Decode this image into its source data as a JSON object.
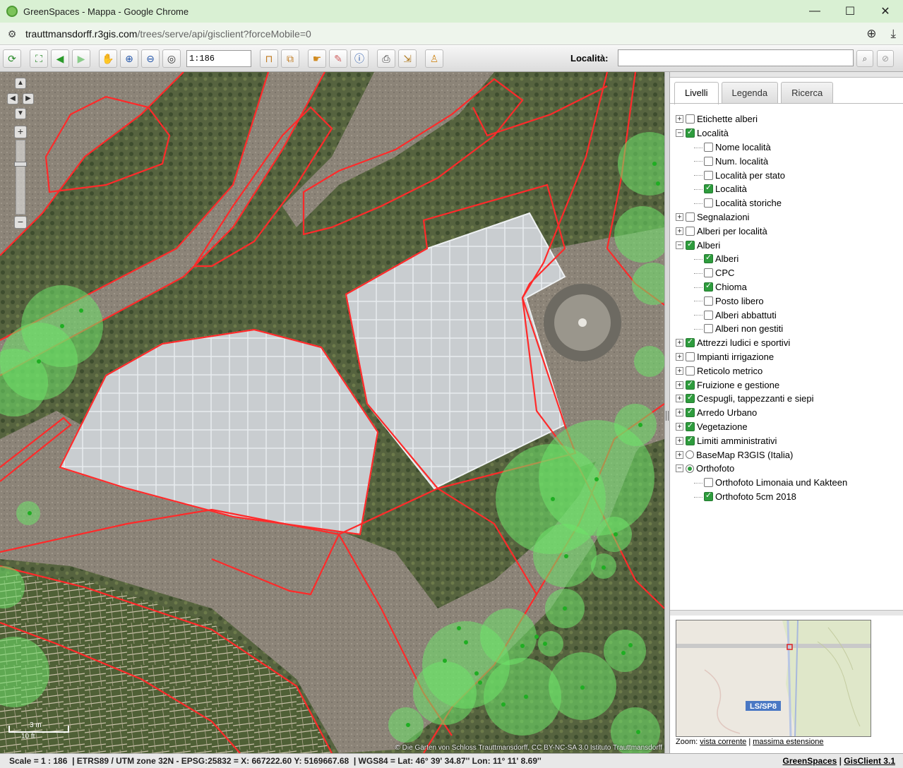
{
  "window": {
    "title": "GreenSpaces - Mappa - Google Chrome",
    "minimize": "—",
    "maximize": "☐",
    "close": "✕"
  },
  "address": {
    "host": "trauttmansdorff.r3gis.com",
    "path": "/trees/serve/api/gisclient?forceMobile=0"
  },
  "toolbar": {
    "scale_value": "1:186",
    "locality_label": "Località:",
    "locality_placeholder": ""
  },
  "map": {
    "attribution": "© Die Gärten von Schloss Trauttmansdorff, CC BY-NC-SA 3.0 Istituto Trauttmansdorff",
    "scalebar_top": "3 m",
    "scalebar_bottom": "10 ft"
  },
  "panel": {
    "tabs": [
      {
        "label": "Livelli",
        "active": true
      },
      {
        "label": "Legenda",
        "active": false
      },
      {
        "label": "Ricerca",
        "active": false
      }
    ],
    "layers": [
      {
        "label": "Etichette alberi",
        "level": 0,
        "expander": "+",
        "control": "checkbox",
        "checked": false
      },
      {
        "label": "Località",
        "level": 0,
        "expander": "−",
        "control": "checkbox",
        "checked": true
      },
      {
        "label": "Nome località",
        "level": 1,
        "control": "checkbox",
        "checked": false
      },
      {
        "label": "Num. località",
        "level": 1,
        "control": "checkbox",
        "checked": false
      },
      {
        "label": "Località per stato",
        "level": 1,
        "control": "checkbox",
        "checked": false
      },
      {
        "label": "Località",
        "level": 1,
        "control": "checkbox",
        "checked": true
      },
      {
        "label": "Località storiche",
        "level": 1,
        "control": "checkbox",
        "checked": false
      },
      {
        "label": "Segnalazioni",
        "level": 0,
        "expander": "+",
        "control": "checkbox",
        "checked": false
      },
      {
        "label": "Alberi per località",
        "level": 0,
        "expander": "+",
        "control": "checkbox",
        "checked": false
      },
      {
        "label": "Alberi",
        "level": 0,
        "expander": "−",
        "control": "checkbox",
        "checked": true
      },
      {
        "label": "Alberi",
        "level": 1,
        "control": "checkbox",
        "checked": true
      },
      {
        "label": "CPC",
        "level": 1,
        "control": "checkbox",
        "checked": false
      },
      {
        "label": "Chioma",
        "level": 1,
        "control": "checkbox",
        "checked": true
      },
      {
        "label": "Posto libero",
        "level": 1,
        "control": "checkbox",
        "checked": false
      },
      {
        "label": "Alberi abbattuti",
        "level": 1,
        "control": "checkbox",
        "checked": false
      },
      {
        "label": "Alberi non gestiti",
        "level": 1,
        "control": "checkbox",
        "checked": false
      },
      {
        "label": "Attrezzi ludici e sportivi",
        "level": 0,
        "expander": "+",
        "control": "checkbox",
        "checked": true
      },
      {
        "label": "Impianti irrigazione",
        "level": 0,
        "expander": "+",
        "control": "checkbox",
        "checked": false
      },
      {
        "label": "Reticolo metrico",
        "level": 0,
        "expander": "+",
        "control": "checkbox",
        "checked": false
      },
      {
        "label": "Fruizione e gestione",
        "level": 0,
        "expander": "+",
        "control": "checkbox",
        "checked": true
      },
      {
        "label": "Cespugli, tappezzanti e siepi",
        "level": 0,
        "expander": "+",
        "control": "checkbox",
        "checked": true
      },
      {
        "label": "Arredo Urbano",
        "level": 0,
        "expander": "+",
        "control": "checkbox",
        "checked": true
      },
      {
        "label": "Vegetazione",
        "level": 0,
        "expander": "+",
        "control": "checkbox",
        "checked": true
      },
      {
        "label": "Limiti amministrativi",
        "level": 0,
        "expander": "+",
        "control": "checkbox",
        "checked": true
      },
      {
        "label": "BaseMap R3GIS (Italia)",
        "level": 0,
        "expander": "+",
        "control": "radio",
        "checked": false
      },
      {
        "label": "Orthofoto",
        "level": 0,
        "expander": "−",
        "control": "radio",
        "checked": true
      },
      {
        "label": "Orthofoto Limonaia und Kakteen",
        "level": 1,
        "control": "checkbox",
        "checked": false
      },
      {
        "label": "Orthofoto 5cm 2018",
        "level": 1,
        "control": "checkbox",
        "checked": true
      }
    ],
    "overview_road_label": "LS/SP8",
    "zoom_prefix": "Zoom:",
    "zoom_current": "vista corrente",
    "zoom_sep": "|",
    "zoom_max": "massima estensione"
  },
  "status": {
    "left": "Scale = 1 : 186  | ETRS89 / UTM zone 32N - EPSG:25832 = X: 667222.60 Y: 5169667.68  | WGS84 = Lat: 46° 39' 34.87'' Lon: 11° 11' 8.69''",
    "link1": "GreenSpaces",
    "sep": "|",
    "link2": "GisClient 3.1"
  },
  "colors": {
    "titlebar": "#d9f0d3",
    "boundary": "#ff2a2a",
    "canopy": "#6de36a",
    "tree_point": "#1fae22"
  }
}
